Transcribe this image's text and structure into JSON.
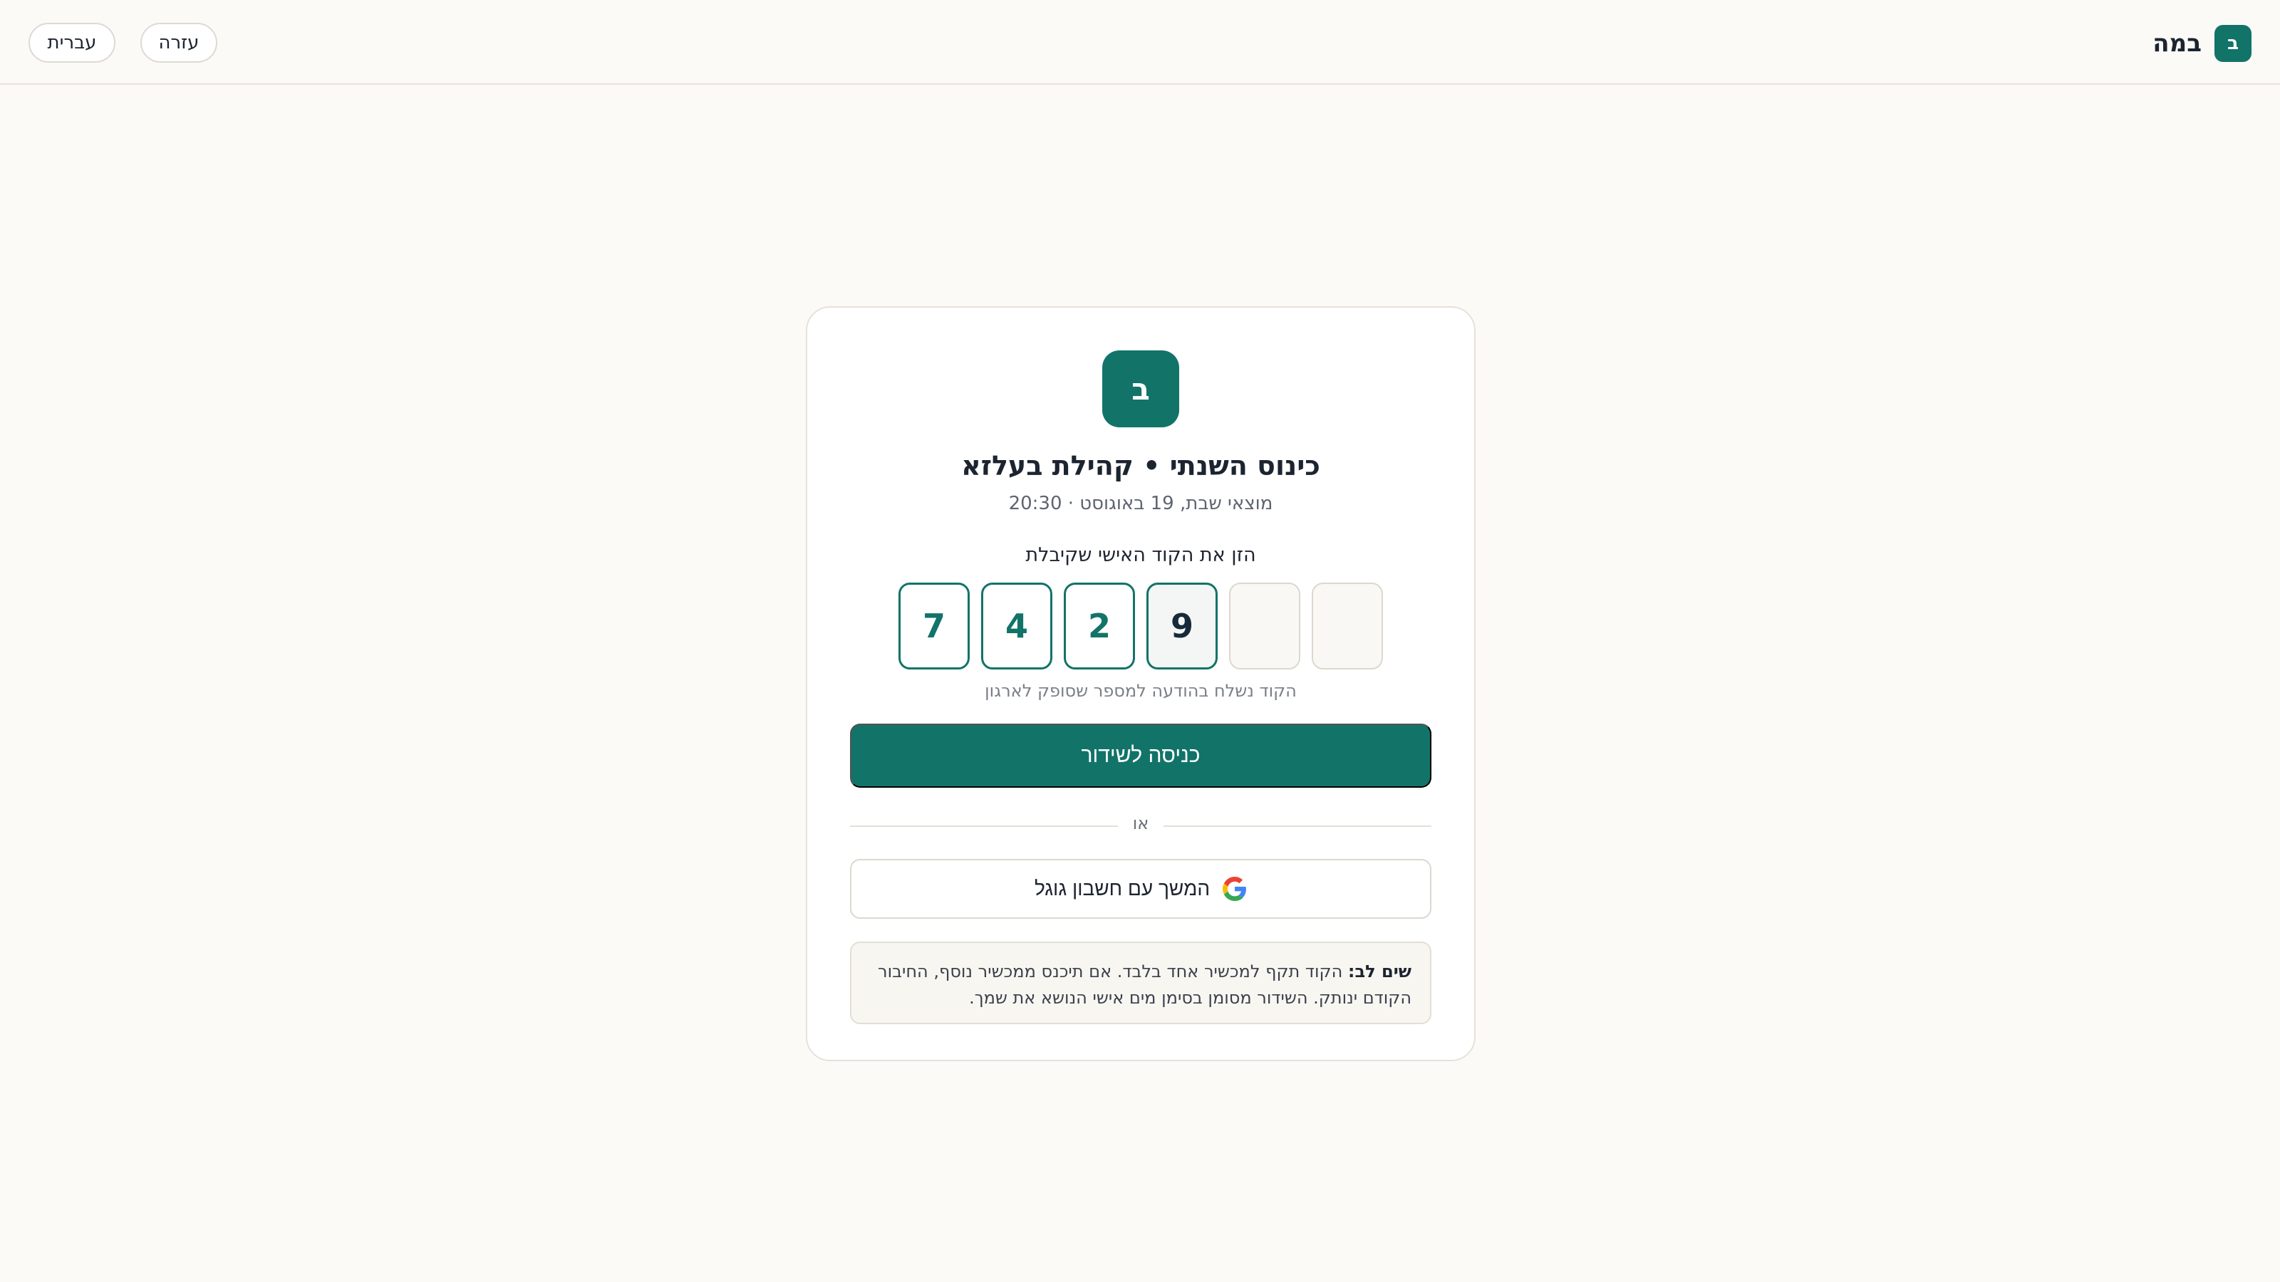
{
  "header": {
    "brand_mark": "ב",
    "brand_name": "במה",
    "help_label": "עזרה",
    "language_label": "עברית"
  },
  "card": {
    "logo_mark": "ב",
    "title": "כינוס השנתי • קהילת בעלזא",
    "subtitle": "מוצאי שבת, 19 באוגוסט · 20:30",
    "code_prompt": "הזן את הקוד האישי שקיבלת",
    "code_digits": [
      "7",
      "4",
      "2",
      "9",
      "",
      ""
    ],
    "code_hint": "הקוד נשלח בהודעה למספר שסופק לארגון",
    "enter_button": "כניסה לשידור",
    "divider_label": "או",
    "google_button": "המשך עם חשבון גוגל",
    "notice_title": "שים לב:",
    "notice_text": "הקוד תקף למכשיר אחד בלבד. אם תיכנס ממכשיר נוסף, החיבור הקודם ינותק. השידור מסומן בסימן מים אישי הנושא את שמך."
  },
  "colors": {
    "accent": "#127369",
    "background": "#fbfaf7"
  }
}
